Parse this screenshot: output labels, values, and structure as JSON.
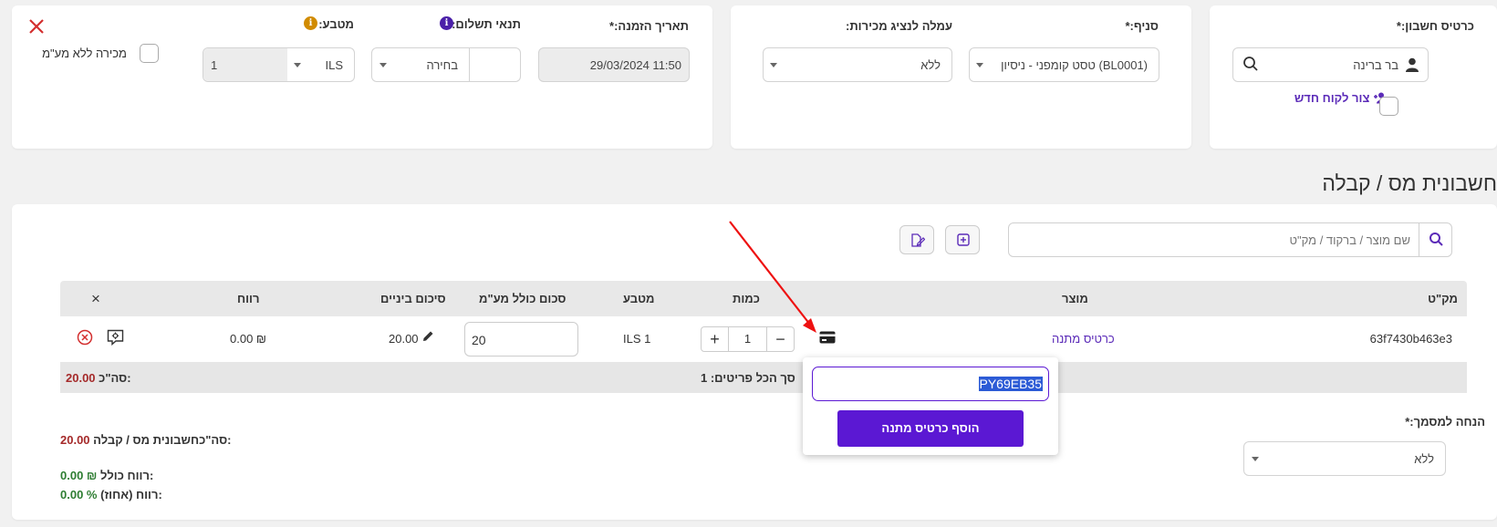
{
  "header": {
    "account_card_label": "כרטיס חשבון:*",
    "account_value": "בר ברינה",
    "add_customer_label": "צור לקוח חדש",
    "branch_label": "סניף:*",
    "branch_value": "טסט קומפני - ניסיון (BL0001)",
    "commission_label": "עמלה לנציג מכירות:",
    "commission_value": "ללא",
    "order_date_label": "תאריך הזמנה:*",
    "order_date_value": "29/03/2024 11:50",
    "payment_terms_label": "תנאי תשלום:",
    "payment_terms_value": "בחירה",
    "currency_label": "מטבע:",
    "currency_value": "ILS",
    "currency_rate": "1",
    "no_vat_label": "מכירה ללא מע\"מ"
  },
  "page_title": "חשבונית מס / קבלה",
  "search": {
    "placeholder": "שם מוצר / ברקוד / מק\"ט"
  },
  "table": {
    "headers": {
      "sku": "מק\"ט",
      "product": "מוצר",
      "quantity": "כמות",
      "currency": "מטבע",
      "total_incl_vat": "סכום כולל מע\"מ",
      "subtotal": "סיכום ביניים",
      "profit": "רווח",
      "remove": "×"
    },
    "row": {
      "sku": "63f7430b463e3",
      "product": "כרטיס מתנה",
      "quantity": "1",
      "currency": "ILS 1",
      "total_incl_vat": "20",
      "subtotal": "20.00",
      "profit": "0.00 ₪"
    },
    "footer": {
      "items_total_label": "סך הכל פריטים: 1",
      "sum_label": "סה\"כ:",
      "sum_value": "20.00"
    }
  },
  "popup": {
    "code_value": "PY69EB35",
    "add_button": "הוסף כרטיס מתנה"
  },
  "summary": {
    "discount_label": "הנחה למסמך:*",
    "discount_value": "ללא",
    "invoice_total_label": "סה\"כחשבונית מס / קבלה:",
    "invoice_total_value": "20.00",
    "gross_profit_label": "רווח כולל:",
    "gross_profit_value": "0.00 ₪",
    "profit_percent_label": "רווח (אחוז):",
    "profit_percent_value": "0.00 %"
  },
  "colors": {
    "accent": "#5b18d3",
    "link": "#5b2bb8",
    "danger": "#d32f2f",
    "total_red": "#a52a2a",
    "profit_green": "#2e7d32",
    "arrow": "#ee1111",
    "info_orange": "#d18b00"
  }
}
